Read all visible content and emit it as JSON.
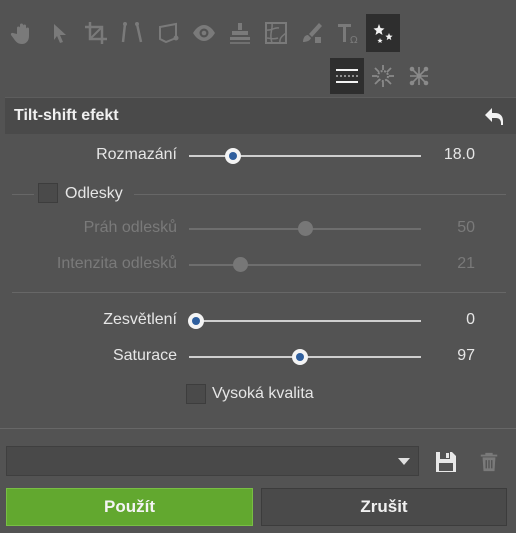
{
  "toolbar": {
    "tools": [
      "hand-icon",
      "pointer-icon",
      "crop-icon",
      "perspective-icon",
      "transform-icon",
      "eye-icon",
      "clone-stamp-icon",
      "texture-icon",
      "brush-icon",
      "text-icon",
      "effects-icon"
    ],
    "active_tool": "effects-icon"
  },
  "subtools": {
    "items": [
      "tilt-shift-lines-icon",
      "radial-icon",
      "grid-warp-icon"
    ],
    "active": "tilt-shift-lines-icon"
  },
  "panel": {
    "title": "Tilt-shift efekt"
  },
  "sliders": {
    "blur": {
      "label": "Rozmazání",
      "value": "18.0",
      "fraction": 0.19
    },
    "reflection_threshold": {
      "label": "Práh odlesků",
      "value": "50",
      "fraction": 0.5
    },
    "reflection_intensity": {
      "label": "Intenzita odlesků",
      "value": "21",
      "fraction": 0.22
    },
    "brightening": {
      "label": "Zesvětlení",
      "value": "0",
      "fraction": 0.03
    },
    "saturation": {
      "label": "Saturace",
      "value": "97",
      "fraction": 0.48
    }
  },
  "reflections": {
    "label": "Odlesky",
    "checked": false
  },
  "high_quality": {
    "label": "Vysoká kvalita",
    "checked": false
  },
  "preset": {
    "value": ""
  },
  "buttons": {
    "apply": "Použít",
    "cancel": "Zrušit"
  },
  "colors": {
    "apply_bg": "#62a82f",
    "thumb_center": "#2f5f9e",
    "panel_bg": "#535353"
  }
}
